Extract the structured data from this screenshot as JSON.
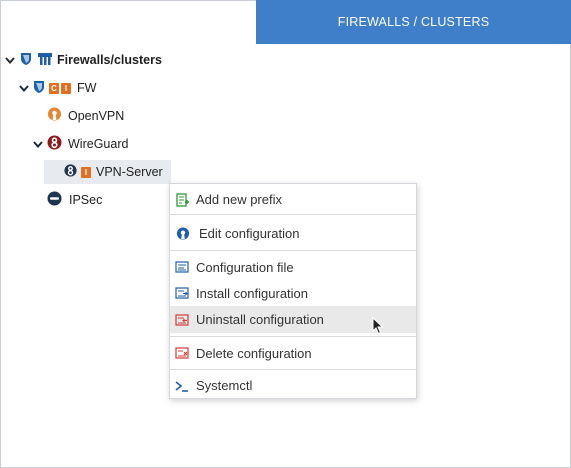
{
  "header": {
    "title": "FIREWALLS / CLUSTERS",
    "color": "#3f7fc9"
  },
  "tree": {
    "root_label": "Firewalls/clusters",
    "fw": {
      "badge_c": "C",
      "badge_i": "I",
      "label": "FW"
    },
    "openvpn_label": "OpenVPN",
    "wireguard_label": "WireGuard",
    "vpn_server": {
      "badge_i": "I",
      "label": "VPN-Server"
    },
    "ipsec_label": "IPSec"
  },
  "context_menu": {
    "add_new_prefix": "Add new prefix",
    "edit_configuration": "Edit configuration",
    "configuration_file": "Configuration file",
    "install_configuration": "Install configuration",
    "uninstall_configuration": "Uninstall configuration",
    "delete_configuration": "Delete configuration",
    "systemctl": "Systemctl"
  },
  "colors": {
    "accent": "#3f7fc9",
    "shield": "#1f5fa8",
    "badge_orange": "#e0701f",
    "wireguard": "#8b1a1a",
    "openvpn": "#e8872e",
    "ipsec": "#1e3550",
    "delete_red": "#d33a3a",
    "hover": "#e9e9e9"
  },
  "icons": [
    "chevron-down-icon",
    "shield-icon",
    "firewall-icon",
    "openvpn-icon",
    "wireguard-icon",
    "ipsec-icon",
    "add-prefix-icon",
    "edit-icon",
    "config-file-icon",
    "install-icon",
    "uninstall-icon",
    "delete-icon",
    "terminal-icon",
    "mouse-cursor-icon"
  ]
}
